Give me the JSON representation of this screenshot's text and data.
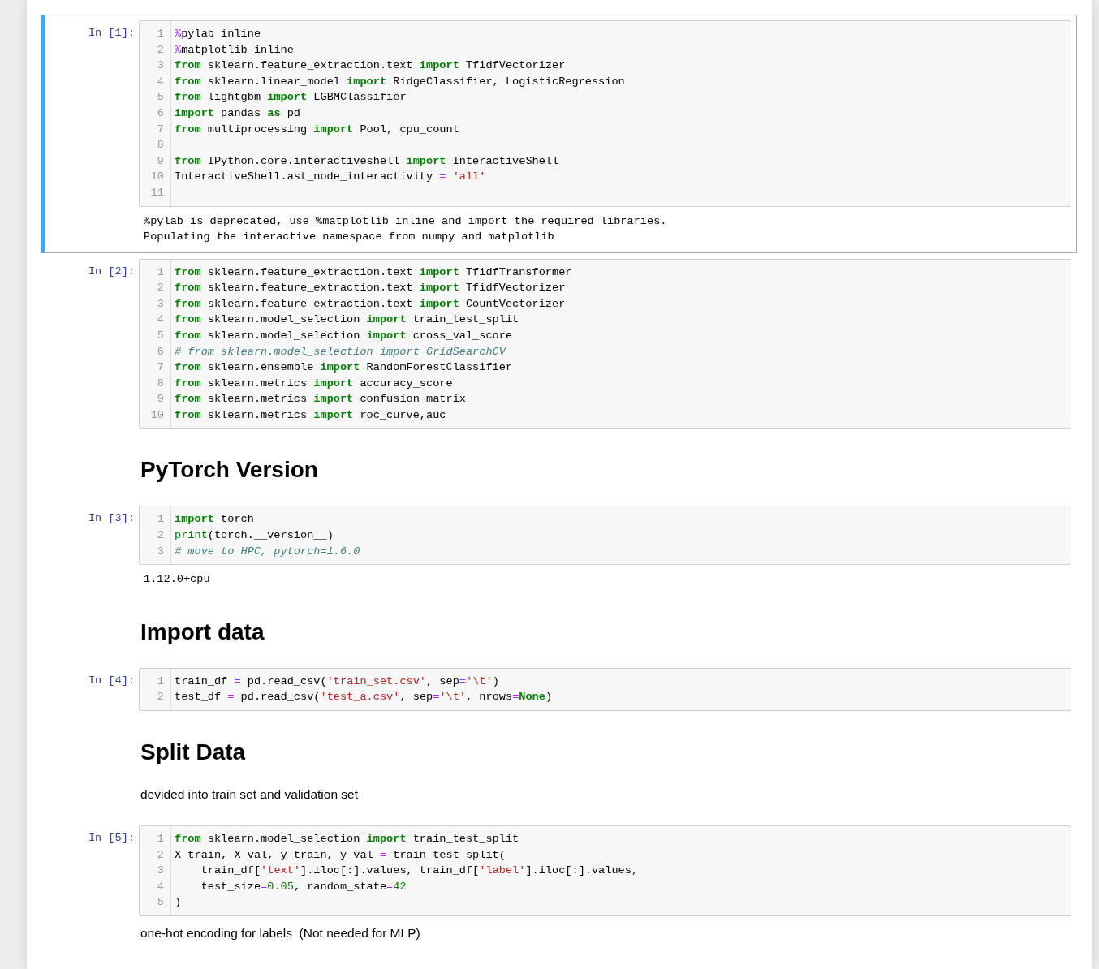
{
  "cells": [
    {
      "kind": "code",
      "prompt": "In [1]:",
      "selected": true,
      "lines": [
        {
          "number": "1",
          "tokens": [
            {
              "kind": "magic",
              "text": "%"
            },
            {
              "kind": "plain",
              "text": "pylab inline"
            }
          ]
        },
        {
          "number": "2",
          "tokens": [
            {
              "kind": "magic",
              "text": "%"
            },
            {
              "kind": "plain",
              "text": "matplotlib inline"
            }
          ]
        },
        {
          "number": "3",
          "tokens": [
            {
              "kind": "kw",
              "text": "from"
            },
            {
              "kind": "plain",
              "text": " sklearn.feature_extraction.text "
            },
            {
              "kind": "kw",
              "text": "import"
            },
            {
              "kind": "plain",
              "text": " TfidfVectorizer"
            }
          ]
        },
        {
          "number": "4",
          "tokens": [
            {
              "kind": "kw",
              "text": "from"
            },
            {
              "kind": "plain",
              "text": " sklearn.linear_model "
            },
            {
              "kind": "kw",
              "text": "import"
            },
            {
              "kind": "plain",
              "text": " RidgeClassifier, LogisticRegression"
            }
          ]
        },
        {
          "number": "5",
          "tokens": [
            {
              "kind": "kw",
              "text": "from"
            },
            {
              "kind": "plain",
              "text": " lightgbm "
            },
            {
              "kind": "kw",
              "text": "import"
            },
            {
              "kind": "plain",
              "text": " LGBMClassifier"
            }
          ]
        },
        {
          "number": "6",
          "tokens": [
            {
              "kind": "kw",
              "text": "import"
            },
            {
              "kind": "plain",
              "text": " pandas "
            },
            {
              "kind": "kw",
              "text": "as"
            },
            {
              "kind": "plain",
              "text": " pd"
            }
          ]
        },
        {
          "number": "7",
          "tokens": [
            {
              "kind": "kw",
              "text": "from"
            },
            {
              "kind": "plain",
              "text": " multiprocessing "
            },
            {
              "kind": "kw",
              "text": "import"
            },
            {
              "kind": "plain",
              "text": " Pool, cpu_count"
            }
          ]
        },
        {
          "number": "8"
        },
        {
          "number": "9",
          "tokens": [
            {
              "kind": "kw",
              "text": "from"
            },
            {
              "kind": "plain",
              "text": " IPython.core.interactiveshell "
            },
            {
              "kind": "kw",
              "text": "import"
            },
            {
              "kind": "plain",
              "text": " InteractiveShell"
            }
          ]
        },
        {
          "number": "10",
          "tokens": [
            {
              "kind": "plain",
              "text": "InteractiveShell.ast_node_interactivity "
            },
            {
              "kind": "op",
              "text": "= "
            },
            {
              "kind": "str",
              "text": "'all'"
            }
          ]
        },
        {
          "number": "11"
        }
      ],
      "output": [
        "%pylab is deprecated, use %matplotlib inline and import the required libraries.",
        "Populating the interactive namespace from numpy and matplotlib"
      ]
    },
    {
      "kind": "code",
      "prompt": "In [2]:",
      "selected": false,
      "lines": [
        {
          "number": "1",
          "tokens": [
            {
              "kind": "kw",
              "text": "from"
            },
            {
              "kind": "plain",
              "text": " sklearn.feature_extraction.text "
            },
            {
              "kind": "kw",
              "text": "import"
            },
            {
              "kind": "plain",
              "text": " TfidfTransformer"
            }
          ]
        },
        {
          "number": "2",
          "tokens": [
            {
              "kind": "kw",
              "text": "from"
            },
            {
              "kind": "plain",
              "text": " sklearn.feature_extraction.text "
            },
            {
              "kind": "kw",
              "text": "import"
            },
            {
              "kind": "plain",
              "text": " TfidfVectorizer"
            }
          ]
        },
        {
          "number": "3",
          "tokens": [
            {
              "kind": "kw",
              "text": "from"
            },
            {
              "kind": "plain",
              "text": " sklearn.feature_extraction.text "
            },
            {
              "kind": "kw",
              "text": "import"
            },
            {
              "kind": "plain",
              "text": " CountVectorizer"
            }
          ]
        },
        {
          "number": "4",
          "tokens": [
            {
              "kind": "kw",
              "text": "from"
            },
            {
              "kind": "plain",
              "text": " sklearn.model_selection "
            },
            {
              "kind": "kw",
              "text": "import"
            },
            {
              "kind": "plain",
              "text": " train_test_split"
            }
          ]
        },
        {
          "number": "5",
          "tokens": [
            {
              "kind": "kw",
              "text": "from"
            },
            {
              "kind": "plain",
              "text": " sklearn.model_selection "
            },
            {
              "kind": "kw",
              "text": "import"
            },
            {
              "kind": "plain",
              "text": " cross_val_score"
            }
          ]
        },
        {
          "number": "6",
          "tokens": [
            {
              "kind": "comment",
              "text": "# from sklearn.model_selection import GridSearchCV"
            }
          ]
        },
        {
          "number": "7",
          "tokens": [
            {
              "kind": "kw",
              "text": "from"
            },
            {
              "kind": "plain",
              "text": " sklearn.ensemble "
            },
            {
              "kind": "kw",
              "text": "import"
            },
            {
              "kind": "plain",
              "text": " RandomForestClassifier"
            }
          ]
        },
        {
          "number": "8",
          "tokens": [
            {
              "kind": "kw",
              "text": "from"
            },
            {
              "kind": "plain",
              "text": " sklearn.metrics "
            },
            {
              "kind": "kw",
              "text": "import"
            },
            {
              "kind": "plain",
              "text": " accuracy_score"
            }
          ]
        },
        {
          "number": "9",
          "tokens": [
            {
              "kind": "kw",
              "text": "from"
            },
            {
              "kind": "plain",
              "text": " sklearn.metrics "
            },
            {
              "kind": "kw",
              "text": "import"
            },
            {
              "kind": "plain",
              "text": " confusion_matrix"
            }
          ]
        },
        {
          "number": "10",
          "tokens": [
            {
              "kind": "kw",
              "text": "from"
            },
            {
              "kind": "plain",
              "text": " sklearn.metrics "
            },
            {
              "kind": "kw",
              "text": "import"
            },
            {
              "kind": "plain",
              "text": " roc_curve,auc"
            }
          ]
        }
      ]
    },
    {
      "kind": "heading",
      "text": "PyTorch Version"
    },
    {
      "kind": "code",
      "prompt": "In [3]:",
      "selected": false,
      "lines": [
        {
          "number": "1",
          "tokens": [
            {
              "kind": "kw",
              "text": "import"
            },
            {
              "kind": "plain",
              "text": " torch"
            }
          ]
        },
        {
          "number": "2",
          "tokens": [
            {
              "kind": "builtin",
              "text": "print"
            },
            {
              "kind": "plain",
              "text": "(torch.__version__)"
            }
          ]
        },
        {
          "number": "3",
          "tokens": [
            {
              "kind": "comment",
              "text": "# move to HPC, pytorch=1.6.0"
            }
          ]
        }
      ],
      "output": [
        "1.12.0+cpu"
      ]
    },
    {
      "kind": "heading",
      "text": "Import data"
    },
    {
      "kind": "code",
      "prompt": "In [4]:",
      "selected": false,
      "lines": [
        {
          "number": "1",
          "tokens": [
            {
              "kind": "plain",
              "text": "train_df "
            },
            {
              "kind": "op",
              "text": "="
            },
            {
              "kind": "plain",
              "text": " pd.read_csv("
            },
            {
              "kind": "str",
              "text": "'train_set.csv'"
            },
            {
              "kind": "plain",
              "text": ", sep"
            },
            {
              "kind": "op",
              "text": "="
            },
            {
              "kind": "str",
              "text": "'\\t'"
            },
            {
              "kind": "plain",
              "text": ")"
            }
          ]
        },
        {
          "number": "2",
          "tokens": [
            {
              "kind": "plain",
              "text": "test_df "
            },
            {
              "kind": "op",
              "text": "="
            },
            {
              "kind": "plain",
              "text": " pd.read_csv("
            },
            {
              "kind": "str",
              "text": "'test_a.csv'"
            },
            {
              "kind": "plain",
              "text": ", sep"
            },
            {
              "kind": "op",
              "text": "="
            },
            {
              "kind": "str",
              "text": "'\\t'"
            },
            {
              "kind": "plain",
              "text": ", nrows"
            },
            {
              "kind": "op",
              "text": "="
            },
            {
              "kind": "kw",
              "text": "None"
            },
            {
              "kind": "plain",
              "text": ")"
            }
          ]
        }
      ]
    },
    {
      "kind": "heading",
      "text": "Split Data"
    },
    {
      "kind": "paragraph",
      "text": "devided into train set and validation set"
    },
    {
      "kind": "code",
      "prompt": "In [5]:",
      "selected": false,
      "lines": [
        {
          "number": "1",
          "tokens": [
            {
              "kind": "kw",
              "text": "from"
            },
            {
              "kind": "plain",
              "text": " sklearn.model_selection "
            },
            {
              "kind": "kw",
              "text": "import"
            },
            {
              "kind": "plain",
              "text": " train_test_split"
            }
          ]
        },
        {
          "number": "2",
          "tokens": [
            {
              "kind": "plain",
              "text": "X_train, X_val, y_train, y_val "
            },
            {
              "kind": "op",
              "text": "="
            },
            {
              "kind": "plain",
              "text": " train_test_split("
            }
          ]
        },
        {
          "number": "3",
          "tokens": [
            {
              "kind": "plain",
              "text": "    train_df["
            },
            {
              "kind": "str",
              "text": "'text'"
            },
            {
              "kind": "plain",
              "text": "].iloc[:].values, train_df["
            },
            {
              "kind": "str",
              "text": "'label'"
            },
            {
              "kind": "plain",
              "text": "].iloc[:].values,"
            }
          ]
        },
        {
          "number": "4",
          "tokens": [
            {
              "kind": "plain",
              "text": "    test_size"
            },
            {
              "kind": "op",
              "text": "="
            },
            {
              "kind": "num",
              "text": "0.05"
            },
            {
              "kind": "plain",
              "text": ", random_state"
            },
            {
              "kind": "op",
              "text": "="
            },
            {
              "kind": "num",
              "text": "42"
            }
          ]
        },
        {
          "number": "5",
          "tokens": [
            {
              "kind": "plain",
              "text": ")"
            }
          ]
        }
      ]
    },
    {
      "kind": "paragraph",
      "text": "one-hot encoding for labels  (Not needed for MLP)"
    }
  ]
}
